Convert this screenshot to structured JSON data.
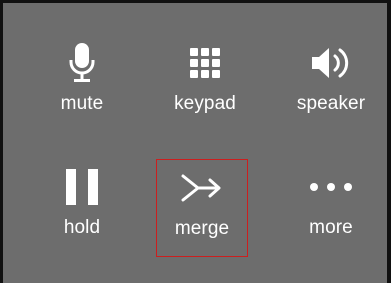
{
  "call_controls": {
    "buttons": [
      {
        "id": "mute",
        "label": "mute",
        "icon": "microphone-icon"
      },
      {
        "id": "keypad",
        "label": "keypad",
        "icon": "keypad-icon"
      },
      {
        "id": "speaker",
        "label": "speaker",
        "icon": "speaker-icon"
      },
      {
        "id": "hold",
        "label": "hold",
        "icon": "pause-icon"
      },
      {
        "id": "merge",
        "label": "merge",
        "icon": "merge-arrow-icon",
        "highlighted": true
      },
      {
        "id": "more",
        "label": "more",
        "icon": "more-dots-icon"
      }
    ]
  },
  "colors": {
    "background": "#6d6d6d",
    "foreground": "#ffffff",
    "highlight_border": "#cc1f1f",
    "frame": "#111111"
  }
}
